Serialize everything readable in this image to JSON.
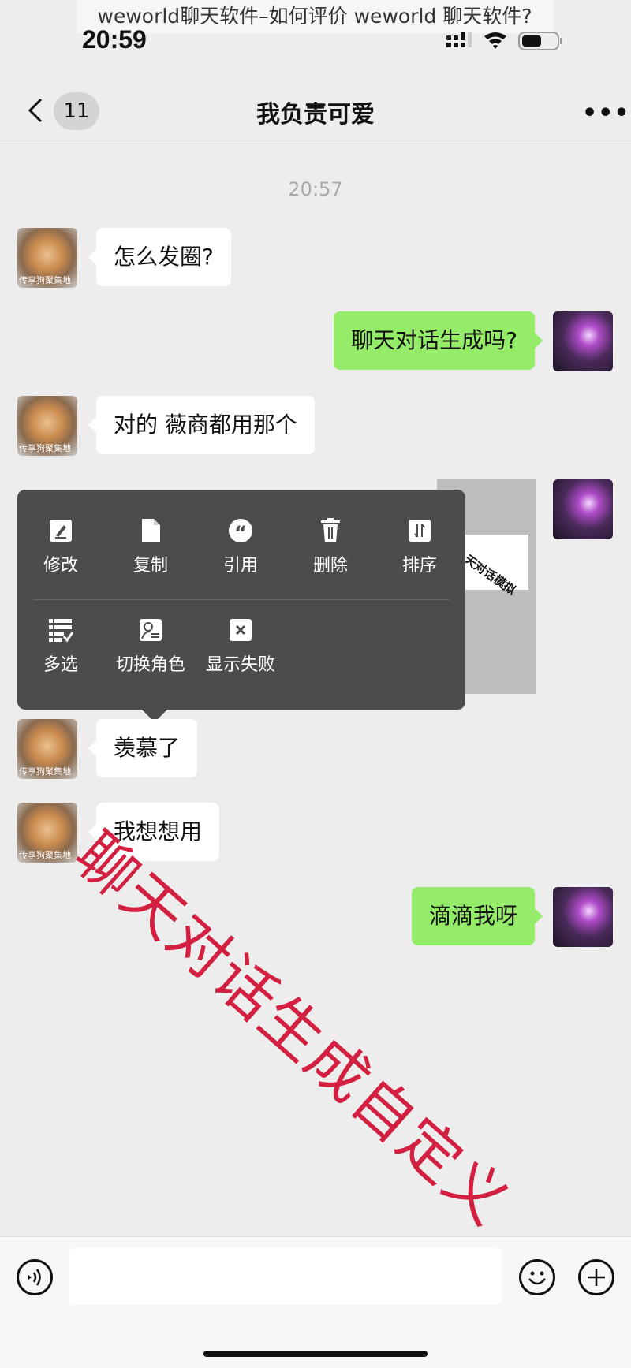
{
  "caption": "weworld聊天软件–如何评价 weworld 聊天软件?",
  "status_bar": {
    "time": "20:59",
    "icons": [
      "signal-icon",
      "wifi-icon",
      "battery-icon"
    ]
  },
  "nav": {
    "back_icon": "chevron-left-icon",
    "unread_count": "11",
    "title": "我负责可爱",
    "more_icon": "more-icon"
  },
  "timestamp": "20:57",
  "messages": [
    {
      "side": "left",
      "text": "怎么发圈?",
      "avatar_caption": "传享狗聚集地"
    },
    {
      "side": "right",
      "text": "聊天对话生成吗?"
    },
    {
      "side": "left",
      "text": "对的 薇商都用那个",
      "avatar_caption": "传享狗聚集地"
    },
    {
      "side": "right",
      "type": "image",
      "image_text": "天对话模拟"
    },
    {
      "side": "left",
      "text": "羡慕了",
      "avatar_caption": "传享狗聚集地"
    },
    {
      "side": "left",
      "text": "我想想用",
      "avatar_caption": "传享狗聚集地"
    },
    {
      "side": "right",
      "text": "滴滴我呀"
    }
  ],
  "context_menu": {
    "items": [
      {
        "label": "修改",
        "icon": "edit-icon"
      },
      {
        "label": "复制",
        "icon": "copy-icon"
      },
      {
        "label": "引用",
        "icon": "quote-icon"
      },
      {
        "label": "删除",
        "icon": "trash-icon"
      },
      {
        "label": "排序",
        "icon": "sort-icon"
      },
      {
        "label": "多选",
        "icon": "multiselect-icon"
      },
      {
        "label": "切换角色",
        "icon": "switch-role-icon"
      },
      {
        "label": "显示失败",
        "icon": "fail-icon"
      }
    ]
  },
  "watermark": "聊天对话生成自定义",
  "input_bar": {
    "voice_icon": "voice-icon",
    "input_value": "",
    "emoji_icon": "emoji-icon",
    "plus_icon": "plus-icon"
  },
  "colors": {
    "background": "#ededed",
    "sent_bubble": "#95ec69",
    "received_bubble": "#ffffff",
    "menu": "#4c4c4c",
    "watermark": "#d42040"
  }
}
